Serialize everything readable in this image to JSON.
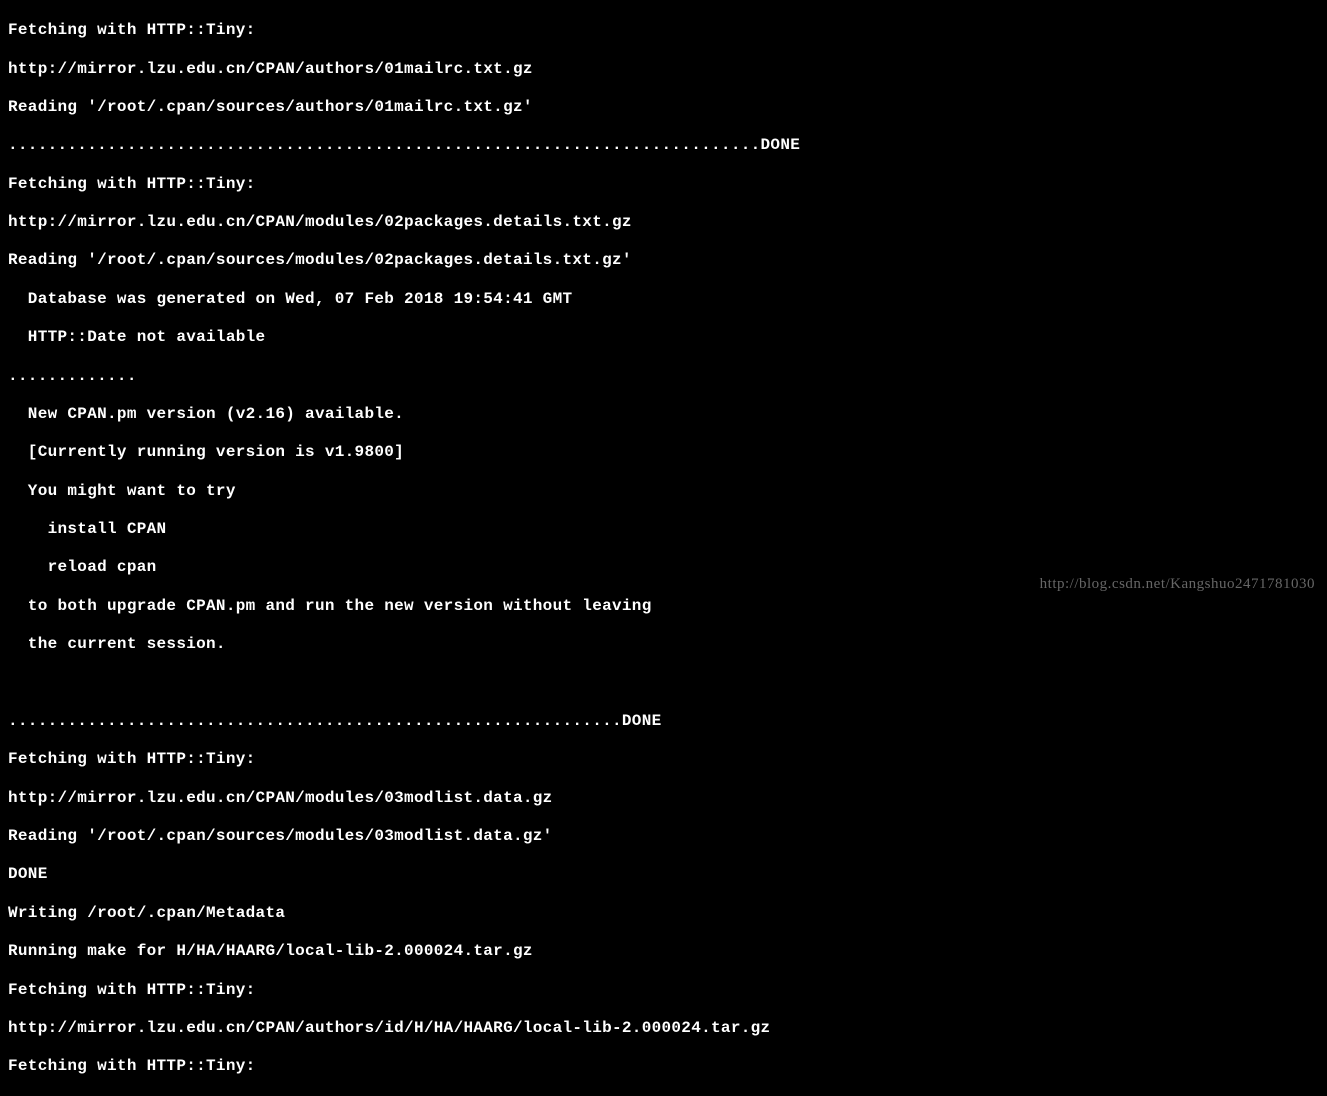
{
  "terminal": {
    "lines": [
      "Fetching with HTTP::Tiny:",
      "http://mirror.lzu.edu.cn/CPAN/authors/01mailrc.txt.gz",
      "Reading '/root/.cpan/sources/authors/01mailrc.txt.gz'",
      "............................................................................DONE",
      "Fetching with HTTP::Tiny:",
      "http://mirror.lzu.edu.cn/CPAN/modules/02packages.details.txt.gz",
      "Reading '/root/.cpan/sources/modules/02packages.details.txt.gz'",
      "  Database was generated on Wed, 07 Feb 2018 19:54:41 GMT",
      "  HTTP::Date not available",
      ".............",
      "  New CPAN.pm version (v2.16) available.",
      "  [Currently running version is v1.9800]",
      "  You might want to try",
      "    install CPAN",
      "    reload cpan",
      "  to both upgrade CPAN.pm and run the new version without leaving",
      "  the current session.",
      "",
      "",
      "..............................................................DONE",
      "Fetching with HTTP::Tiny:",
      "http://mirror.lzu.edu.cn/CPAN/modules/03modlist.data.gz",
      "Reading '/root/.cpan/sources/modules/03modlist.data.gz'",
      "DONE",
      "Writing /root/.cpan/Metadata",
      "Running make for H/HA/HAARG/local-lib-2.000024.tar.gz",
      "Fetching with HTTP::Tiny:",
      "http://mirror.lzu.edu.cn/CPAN/authors/id/H/HA/HAARG/local-lib-2.000024.tar.gz",
      "Fetching with HTTP::Tiny:"
    ]
  },
  "watermark": "http://blog.csdn.net/Kangshuo2471781030"
}
